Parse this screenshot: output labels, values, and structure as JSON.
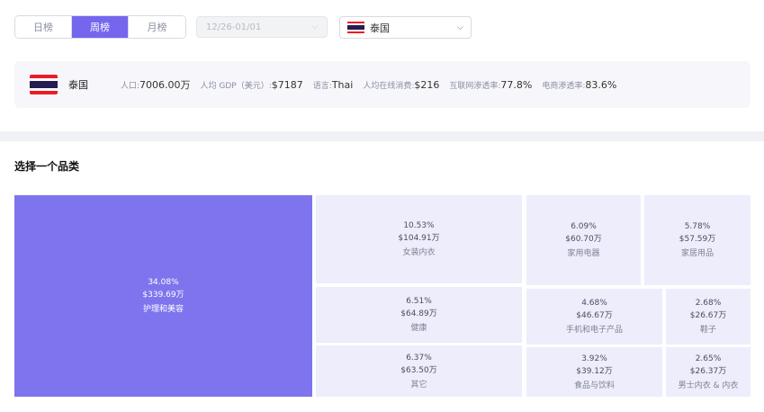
{
  "tabs": [
    {
      "label": "日榜",
      "active": false
    },
    {
      "label": "周榜",
      "active": true
    },
    {
      "label": "月榜",
      "active": false
    }
  ],
  "date_select": {
    "value": "12/26-01/01",
    "disabled": true
  },
  "country_select": {
    "value": "泰国",
    "flag_icon": "thailand-flag-icon"
  },
  "country_info": {
    "name": "泰国",
    "flag_colors": [
      "#ED1C24",
      "#FFFFFF",
      "#241D4F",
      "#FFFFFF",
      "#ED1C24"
    ],
    "stats": [
      {
        "label": "人口:",
        "value": "7006.00万"
      },
      {
        "label": "人均 GDP（美元）:",
        "value": "$7187"
      },
      {
        "label": "语言:",
        "value": "Thai"
      },
      {
        "label": "人均在线消费:",
        "value": "$216"
      },
      {
        "label": "互联网渗透率:",
        "value": "77.8%"
      },
      {
        "label": "电商渗透率:",
        "value": "83.6%"
      }
    ]
  },
  "section_title": "选择一个品类",
  "colors": {
    "accent": "#7566EE",
    "treemap_main": "#7E75EE",
    "treemap_tile": "#EDEDFB"
  },
  "treemap": [
    {
      "pct": "34.08%",
      "value": "$339.69万",
      "category": "护理和美容"
    },
    {
      "pct": "10.53%",
      "value": "$104.91万",
      "category": "女装内衣"
    },
    {
      "pct": "6.51%",
      "value": "$64.89万",
      "category": "健康"
    },
    {
      "pct": "6.37%",
      "value": "$63.50万",
      "category": "其它"
    },
    {
      "pct": "6.09%",
      "value": "$60.70万",
      "category": "家用电器"
    },
    {
      "pct": "5.78%",
      "value": "$57.59万",
      "category": "家居用品"
    },
    {
      "pct": "4.68%",
      "value": "$46.67万",
      "category": "手机和电子产品"
    },
    {
      "pct": "2.68%",
      "value": "$26.67万",
      "category": "鞋子"
    },
    {
      "pct": "3.92%",
      "value": "$39.12万",
      "category": "食品与饮料"
    },
    {
      "pct": "2.65%",
      "value": "$26.37万",
      "category": "男士内衣 & 内衣"
    }
  ]
}
